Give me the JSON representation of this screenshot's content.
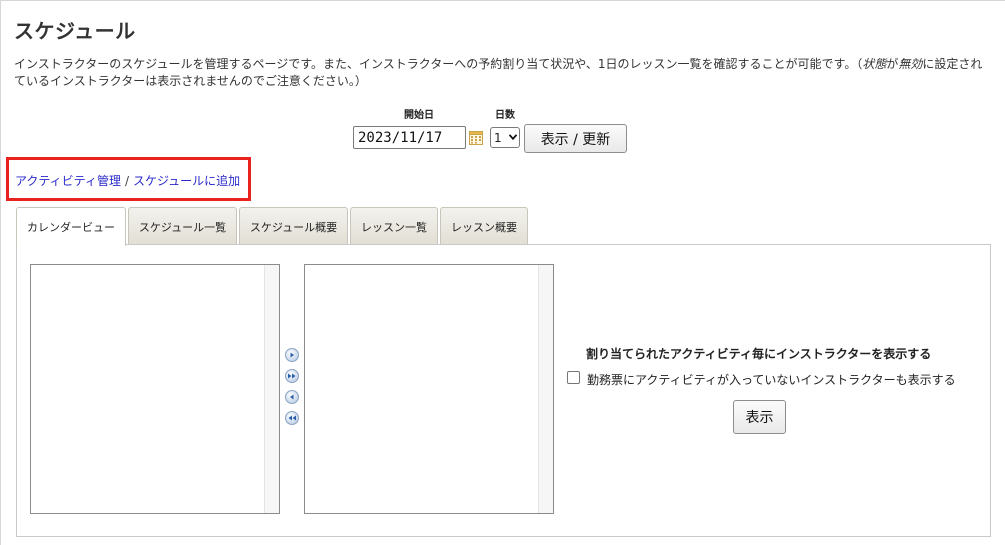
{
  "page": {
    "title": "スケジュール",
    "description_part1": "インストラクターのスケジュールを管理するページです。また、インストラクターへの予約割り当て状況や、1日のレッスン一覧を確認することが可能です。（",
    "description_status": "状態",
    "description_ga": "が",
    "description_invalid": "無効",
    "description_part2": "に設定されているインストラクターは表示されませんのでご注意ください。）"
  },
  "filters": {
    "start_date_label": "開始日",
    "start_date_value": "2023/11/17",
    "days_label": "日数",
    "days_value": "1",
    "refresh_button": "表示 / 更新"
  },
  "breadcrumb": {
    "item1": "アクティビティ管理",
    "separator": "/",
    "item2": "スケジュールに追加"
  },
  "tabs": [
    {
      "label": "カレンダービュー",
      "active": true
    },
    {
      "label": "スケジュール一覧",
      "active": false
    },
    {
      "label": "スケジュール概要",
      "active": false
    },
    {
      "label": "レッスン一覧",
      "active": false
    },
    {
      "label": "レッスン概要",
      "active": false
    }
  ],
  "options": {
    "title": "割り当てられたアクティビティ毎にインストラクターを表示する",
    "checkbox_label": "勤務票にアクティビティが入っていないインストラクターも表示する",
    "checkbox_checked": false,
    "show_button": "表示"
  },
  "icons": {
    "calendar": "calendar-icon",
    "move_right": "move-right-icon",
    "move_all_right": "move-all-right-icon",
    "move_left": "move-left-icon",
    "move_all_left": "move-all-left-icon"
  },
  "colors": {
    "highlight": "#e8231d",
    "link": "#2a2acc"
  }
}
